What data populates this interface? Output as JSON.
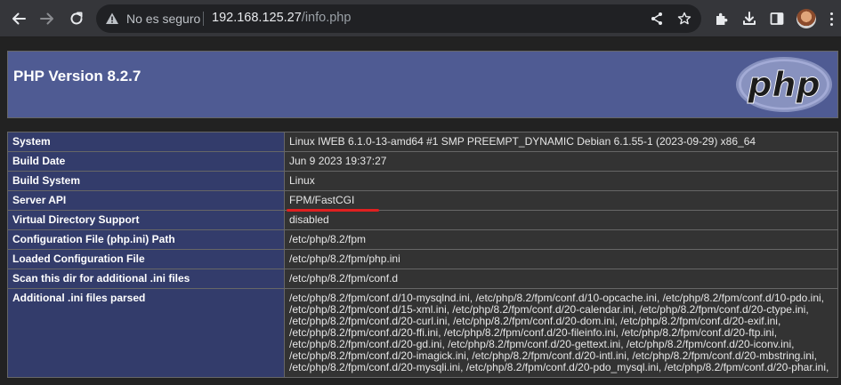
{
  "browser": {
    "security_label": "No es seguro",
    "url_host": "192.168.125.27",
    "url_path": "/info.php",
    "icons": {
      "back": "back-arrow-icon",
      "forward": "forward-arrow-icon",
      "reload": "reload-icon",
      "security": "warning-triangle-icon",
      "share": "share-icon",
      "bookmark": "star-icon",
      "extensions": "puzzle-icon",
      "download": "download-icon",
      "sidepanel": "side-panel-icon",
      "menu": "kebab-menu-icon"
    }
  },
  "php": {
    "title": "PHP Version 8.2.7",
    "logo_text": "php",
    "colors": {
      "header_bg": "#4f5b93",
      "label_bg": "#333c6b",
      "value_bg": "#333333",
      "highlight": "#e02020"
    },
    "rows": [
      {
        "label": "System",
        "value": "Linux IWEB 6.1.0-13-amd64 #1 SMP PREEMPT_DYNAMIC Debian 6.1.55-1 (2023-09-29) x86_64"
      },
      {
        "label": "Build Date",
        "value": "Jun 9 2023 19:37:27"
      },
      {
        "label": "Build System",
        "value": "Linux"
      },
      {
        "label": "Server API",
        "value": "FPM/FastCGI"
      },
      {
        "label": "Virtual Directory Support",
        "value": "disabled"
      },
      {
        "label": "Configuration File (php.ini) Path",
        "value": "/etc/php/8.2/fpm"
      },
      {
        "label": "Loaded Configuration File",
        "value": "/etc/php/8.2/fpm/php.ini"
      },
      {
        "label": "Scan this dir for additional .ini files",
        "value": "/etc/php/8.2/fpm/conf.d"
      },
      {
        "label": "Additional .ini files parsed",
        "value": "/etc/php/8.2/fpm/conf.d/10-mysqlnd.ini, /etc/php/8.2/fpm/conf.d/10-opcache.ini, /etc/php/8.2/fpm/conf.d/10-pdo.ini, /etc/php/8.2/fpm/conf.d/15-xml.ini, /etc/php/8.2/fpm/conf.d/20-calendar.ini, /etc/php/8.2/fpm/conf.d/20-ctype.ini, /etc/php/8.2/fpm/conf.d/20-curl.ini, /etc/php/8.2/fpm/conf.d/20-dom.ini, /etc/php/8.2/fpm/conf.d/20-exif.ini, /etc/php/8.2/fpm/conf.d/20-ffi.ini, /etc/php/8.2/fpm/conf.d/20-fileinfo.ini, /etc/php/8.2/fpm/conf.d/20-ftp.ini, /etc/php/8.2/fpm/conf.d/20-gd.ini, /etc/php/8.2/fpm/conf.d/20-gettext.ini, /etc/php/8.2/fpm/conf.d/20-iconv.ini, /etc/php/8.2/fpm/conf.d/20-imagick.ini, /etc/php/8.2/fpm/conf.d/20-intl.ini, /etc/php/8.2/fpm/conf.d/20-mbstring.ini, /etc/php/8.2/fpm/conf.d/20-mysqli.ini, /etc/php/8.2/fpm/conf.d/20-pdo_mysql.ini, /etc/php/8.2/fpm/conf.d/20-phar.ini,"
      }
    ]
  }
}
